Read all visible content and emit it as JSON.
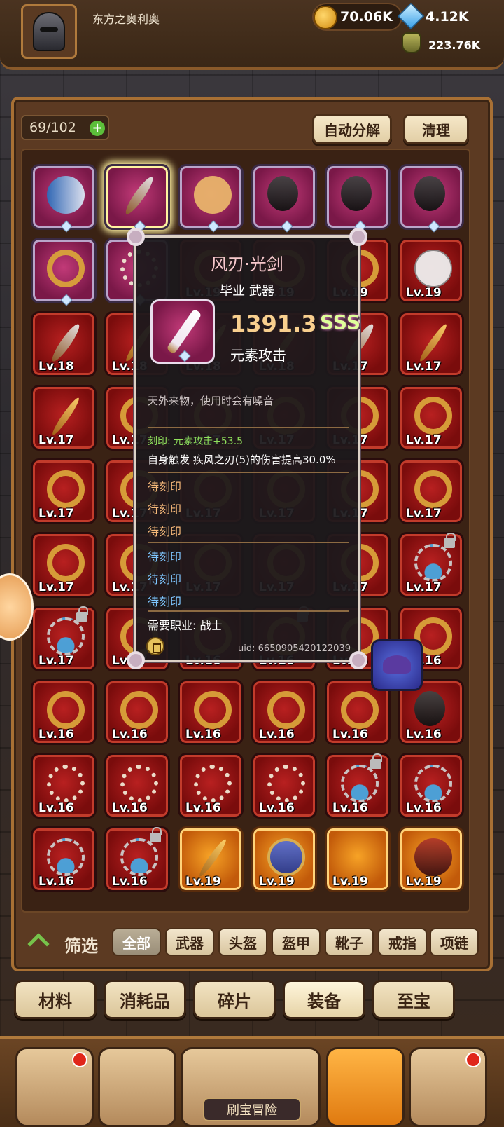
{
  "header": {
    "player_name": "东方之奥利奥",
    "gold": "70.06K",
    "diamonds": "4.12K",
    "potion": "223.76K"
  },
  "inventory": {
    "count": "69/102",
    "auto_decompose": "自动分解",
    "clear": "清理"
  },
  "grid": {
    "rows": [
      [
        {
          "item": "scroll",
          "tier": "pink",
          "lv": ""
        },
        {
          "item": "weapon",
          "tier": "pink",
          "lv": "",
          "selected": true
        },
        {
          "item": "dog",
          "tier": "pink",
          "lv": ""
        },
        {
          "item": "boot",
          "tier": "pink",
          "lv": ""
        },
        {
          "item": "boot",
          "tier": "pink",
          "lv": ""
        },
        {
          "item": "boot",
          "tier": "pink",
          "lv": ""
        }
      ],
      [
        {
          "item": "ring",
          "tier": "pink",
          "lv": ""
        },
        {
          "item": "beads",
          "tier": "pink",
          "lv": ""
        },
        {
          "item": "ring",
          "tier": "red",
          "lv": "Lv.19"
        },
        {
          "item": "ring",
          "tier": "red",
          "lv": "Lv.19"
        },
        {
          "item": "ring",
          "tier": "red",
          "lv": "Lv.19"
        },
        {
          "item": "mask",
          "tier": "red",
          "lv": "Lv.19"
        }
      ],
      [
        {
          "item": "weapon",
          "tier": "red",
          "lv": "Lv.18"
        },
        {
          "item": "staff",
          "tier": "red",
          "lv": "Lv.18"
        },
        {
          "item": "staff",
          "tier": "red",
          "lv": "Lv.18"
        },
        {
          "item": "staff",
          "tier": "red",
          "lv": "Lv.18"
        },
        {
          "item": "weapon",
          "tier": "red",
          "lv": "Lv.17"
        },
        {
          "item": "staff",
          "tier": "red",
          "lv": "Lv.17"
        }
      ],
      [
        {
          "item": "staff",
          "tier": "red",
          "lv": "Lv.17"
        },
        {
          "item": "ring",
          "tier": "red",
          "lv": "Lv.17"
        },
        {
          "item": "ring",
          "tier": "red",
          "lv": "Lv.17"
        },
        {
          "item": "ring",
          "tier": "red",
          "lv": "Lv.17"
        },
        {
          "item": "ring",
          "tier": "red",
          "lv": "Lv.17"
        },
        {
          "item": "ring",
          "tier": "red",
          "lv": "Lv.17"
        }
      ],
      [
        {
          "item": "ring",
          "tier": "red",
          "lv": "Lv.17"
        },
        {
          "item": "ring",
          "tier": "red",
          "lv": "Lv.17"
        },
        {
          "item": "ring",
          "tier": "red",
          "lv": "Lv.17"
        },
        {
          "item": "ring",
          "tier": "red",
          "lv": "Lv.17"
        },
        {
          "item": "ring",
          "tier": "red",
          "lv": "Lv.17"
        },
        {
          "item": "ring",
          "tier": "red",
          "lv": "Lv.17"
        }
      ],
      [
        {
          "item": "ring",
          "tier": "red",
          "lv": "Lv.17"
        },
        {
          "item": "ring",
          "tier": "red",
          "lv": "Lv.17"
        },
        {
          "item": "ring",
          "tier": "red",
          "lv": "Lv.17"
        },
        {
          "item": "ring",
          "tier": "red",
          "lv": "Lv.17"
        },
        {
          "item": "ring",
          "tier": "red",
          "lv": "Lv.17"
        },
        {
          "item": "necklace",
          "tier": "red",
          "lv": "Lv.17",
          "locked": true
        }
      ],
      [
        {
          "item": "necklace",
          "tier": "red",
          "lv": "Lv.17",
          "locked": true
        },
        {
          "item": "ring",
          "tier": "red",
          "lv": "Lv.17"
        },
        {
          "item": "ring",
          "tier": "red",
          "lv": "Lv.16"
        },
        {
          "item": "ring",
          "tier": "red",
          "lv": "Lv.16",
          "locked": true
        },
        {
          "item": "ring",
          "tier": "red",
          "lv": "Lv.16"
        },
        {
          "item": "ring",
          "tier": "red",
          "lv": "Lv.16"
        }
      ],
      [
        {
          "item": "ring",
          "tier": "red",
          "lv": "Lv.16"
        },
        {
          "item": "ring",
          "tier": "red",
          "lv": "Lv.16"
        },
        {
          "item": "ring",
          "tier": "red",
          "lv": "Lv.16"
        },
        {
          "item": "ring",
          "tier": "red",
          "lv": "Lv.16"
        },
        {
          "item": "ring",
          "tier": "red",
          "lv": "Lv.16"
        },
        {
          "item": "boot",
          "tier": "red",
          "lv": "Lv.16"
        }
      ],
      [
        {
          "item": "beads",
          "tier": "red",
          "lv": "Lv.16"
        },
        {
          "item": "beads",
          "tier": "red",
          "lv": "Lv.16"
        },
        {
          "item": "beads",
          "tier": "red",
          "lv": "Lv.16"
        },
        {
          "item": "beads",
          "tier": "red",
          "lv": "Lv.16"
        },
        {
          "item": "necklace",
          "tier": "red",
          "lv": "Lv.16",
          "locked": true
        },
        {
          "item": "necklace",
          "tier": "red",
          "lv": "Lv.16"
        }
      ],
      [
        {
          "item": "necklace",
          "tier": "red",
          "lv": "Lv.16"
        },
        {
          "item": "necklace",
          "tier": "red",
          "lv": "Lv.16",
          "locked": true
        },
        {
          "item": "staff",
          "tier": "gold",
          "lv": "Lv.19"
        },
        {
          "item": "shield",
          "tier": "gold",
          "lv": "Lv.19"
        },
        {
          "item": "",
          "tier": "gold",
          "lv": "Lv.19"
        },
        {
          "item": "armor",
          "tier": "gold",
          "lv": "Lv.19"
        }
      ]
    ]
  },
  "tooltip": {
    "title": "风刃·光剑",
    "subtitle": "毕业 武器",
    "score": "1391.3",
    "grade": "SSS",
    "stat": "元素攻击",
    "description": "天外来物，使用时会有噪音",
    "engrave": "刻印: 元素攻击+53.5",
    "trigger": "自身触发 疾风之刃(5)的伤害提高30.0%",
    "pending": [
      "待刻印",
      "待刻印",
      "待刻印",
      "待刻印",
      "待刻印",
      "待刻印"
    ],
    "requirement": "需要职业: 战士",
    "uid": "uid: 6650905420122039"
  },
  "filter": {
    "label": "筛选",
    "tabs": [
      "全部",
      "武器",
      "头盔",
      "盔甲",
      "靴子",
      "戒指",
      "项链"
    ]
  },
  "categories": [
    "材料",
    "消耗品",
    "碎片",
    "装备",
    "至宝"
  ],
  "bottom_nav": {
    "treasure_label": "刷宝冒险"
  }
}
